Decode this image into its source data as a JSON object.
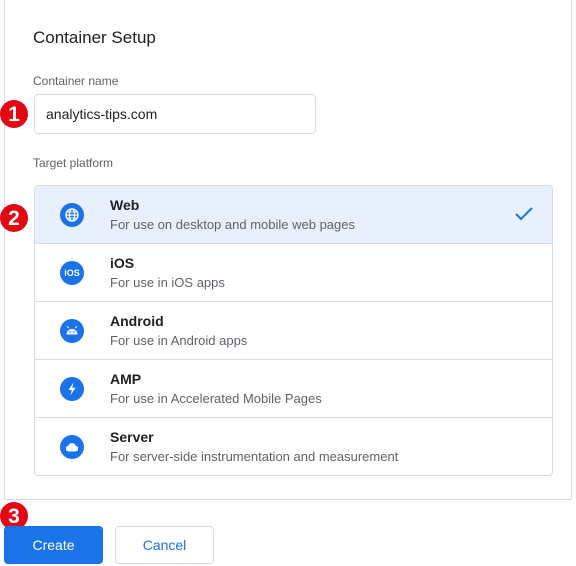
{
  "dialog": {
    "title": "Container Setup",
    "container_name_label": "Container name",
    "container_name_value": "analytics-tips.com",
    "target_platform_label": "Target platform"
  },
  "platforms": [
    {
      "name": "Web",
      "description": "For use on desktop and mobile web pages",
      "icon": "globe-icon",
      "selected": true
    },
    {
      "name": "iOS",
      "description": "For use in iOS apps",
      "icon": "ios-icon",
      "selected": false
    },
    {
      "name": "Android",
      "description": "For use in Android apps",
      "icon": "android-icon",
      "selected": false
    },
    {
      "name": "AMP",
      "description": "For use in Accelerated Mobile Pages",
      "icon": "amp-lightning-icon",
      "selected": false
    },
    {
      "name": "Server",
      "description": "For server-side instrumentation and measurement",
      "icon": "cloud-icon",
      "selected": false
    }
  ],
  "icon_text": {
    "ios": "iOS"
  },
  "buttons": {
    "create": "Create",
    "cancel": "Cancel"
  },
  "annotations": [
    "1",
    "2",
    "3"
  ],
  "colors": {
    "accent": "#1a73e8",
    "selected_row": "#e8f0fe",
    "annotation_badge": "#e30613"
  }
}
